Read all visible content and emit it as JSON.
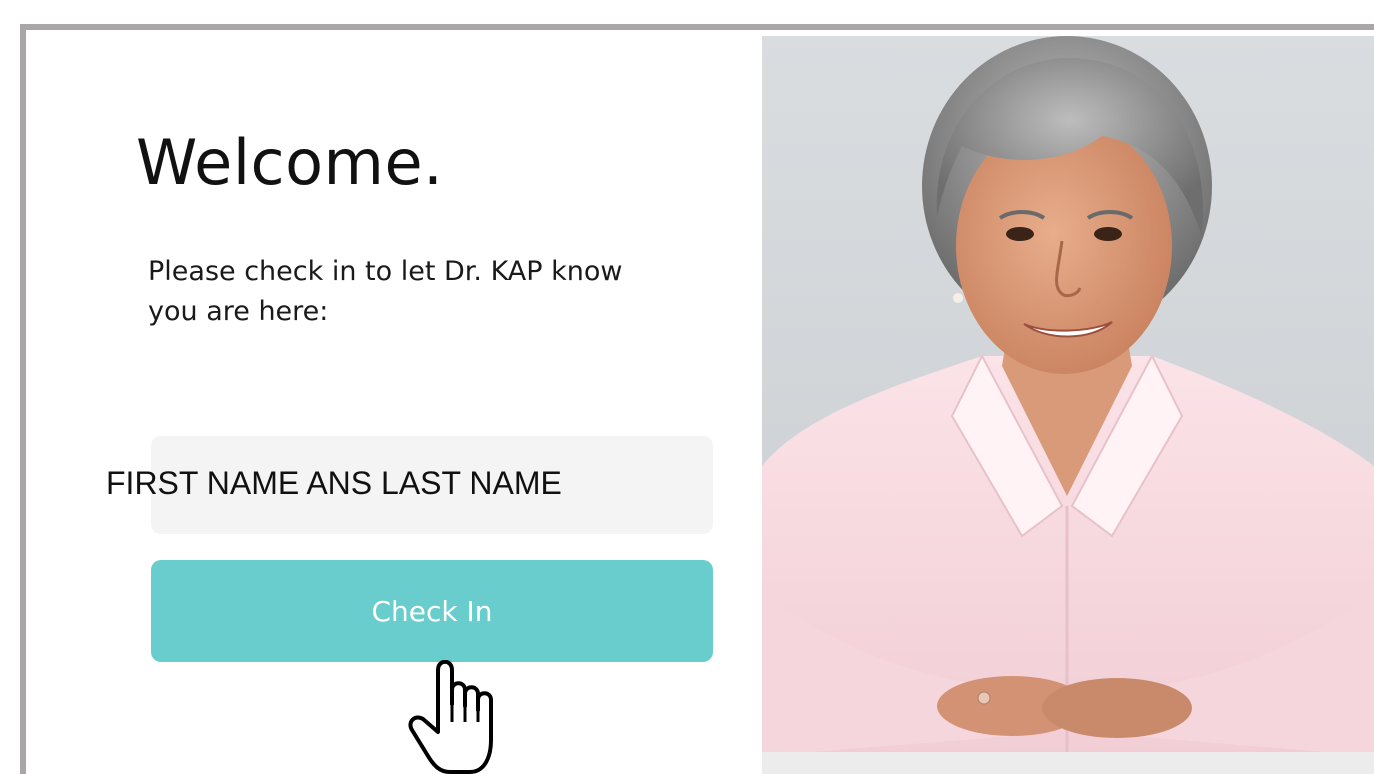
{
  "welcome": {
    "title": "Welcome.",
    "instructions": "Please check in to let Dr. KAP know you are here:"
  },
  "name_field": {
    "placeholder": "FIRST NAME ANS LAST NAME"
  },
  "check_in": {
    "label": "Check In"
  },
  "colors": {
    "accent": "#68cdcc",
    "field_background": "#f4f4f4",
    "frame": "#a8a6a7"
  },
  "icons": {
    "cursor": "hand-pointer-icon"
  }
}
